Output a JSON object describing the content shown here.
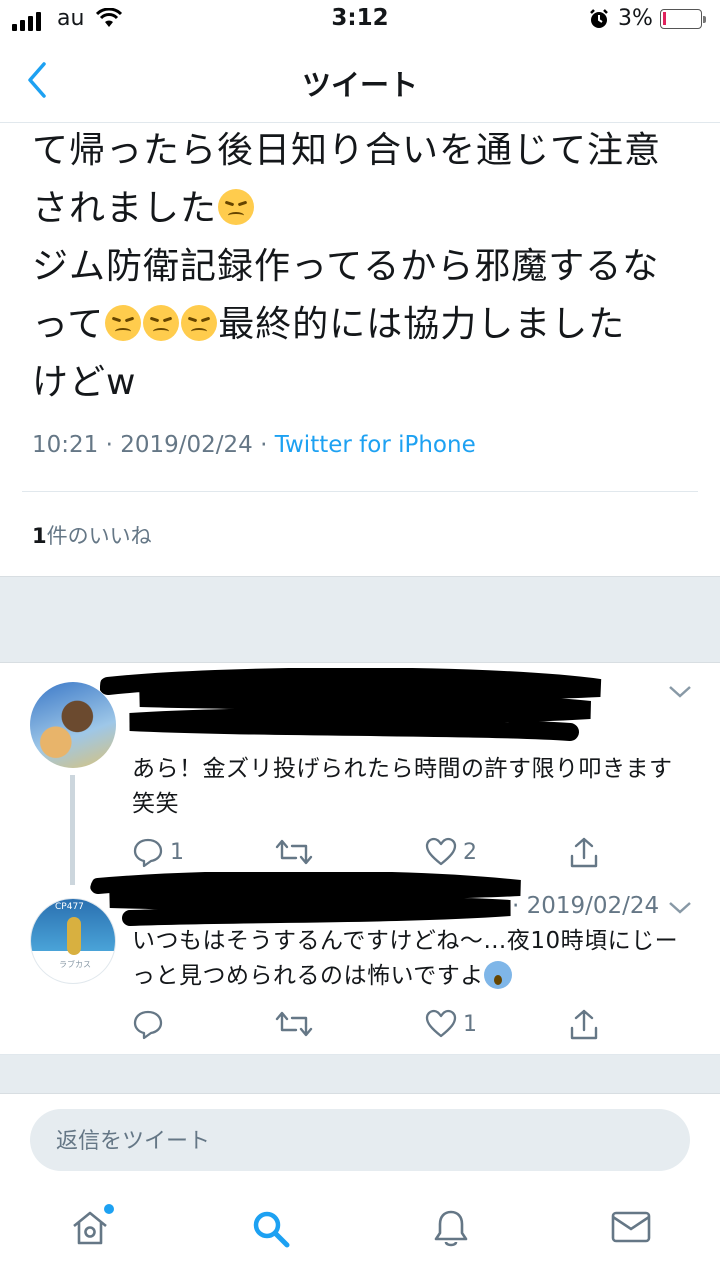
{
  "status_bar": {
    "carrier": "au",
    "time": "3:12",
    "battery_percent": "3%",
    "battery_level": 0.03
  },
  "nav": {
    "title": "ツイート",
    "back_icon": "chevron-left-icon"
  },
  "tweet": {
    "lines": [
      "て帰ったら後日知り合いを通じて注意",
      "されました",
      "ジム防衛記録作ってるから邪魔するな",
      "って",
      "最終的には協力しました",
      "けどw"
    ],
    "emoji": "disappointed-face",
    "time": "10:21",
    "date": "2019/02/24",
    "separator": "·",
    "source": "Twitter for iPhone",
    "likes_count": "1",
    "likes_label": "件のいいね"
  },
  "replies": [
    {
      "text_line1": "あら！金ズリ投げられたら時間の許す限り叩きます",
      "text_line2": "笑笑",
      "reply_count": "1",
      "retweet_count": "",
      "like_count": "2"
    },
    {
      "date": "· 2019/02/24",
      "text_line1": "いつもはそうするんですけどね〜…夜10時頃にじー",
      "text_line2": "っと見つめられるのは怖いですよ",
      "reply_count": "",
      "retweet_count": "",
      "like_count": "1"
    }
  ],
  "avatar2": {
    "cp_text": "CP477",
    "name_text": "ラブカス"
  },
  "composer": {
    "placeholder": "返信をツイート"
  },
  "tabs": [
    "home-icon",
    "search-icon",
    "notifications-icon",
    "messages-icon"
  ],
  "colors": {
    "accent": "#1da1f2",
    "secondary_text": "#657786",
    "divider": "#e1e8ed",
    "gap_background": "#e6ecf0",
    "battery_low": "#e0245e"
  }
}
